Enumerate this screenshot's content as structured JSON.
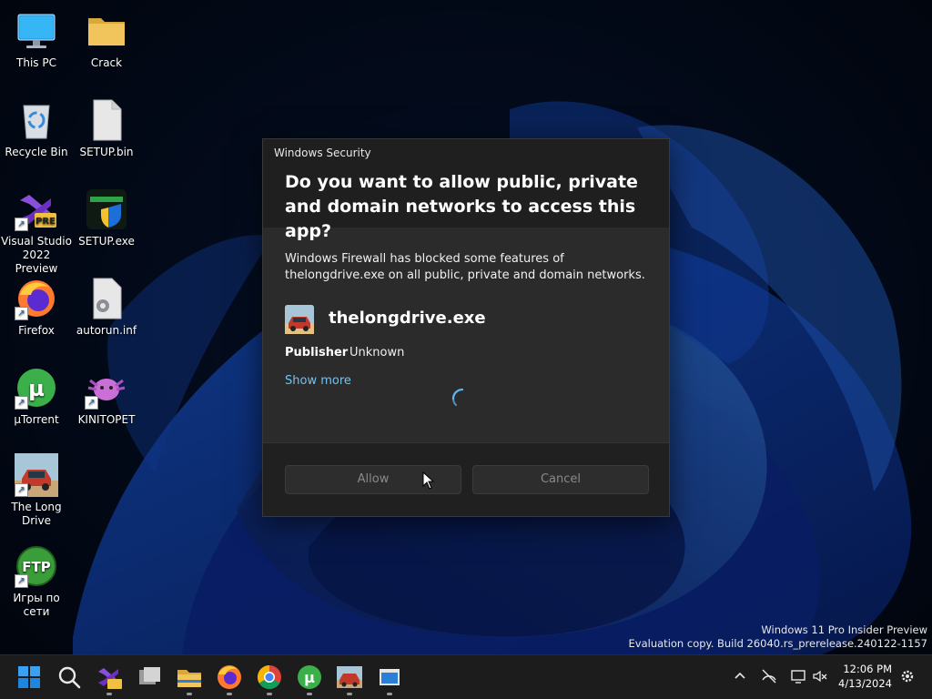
{
  "desktop": {
    "icons": [
      {
        "label": "This PC",
        "icon": "monitor-icon"
      },
      {
        "label": "Crack",
        "icon": "folder-icon"
      },
      {
        "label": "Recycle Bin",
        "icon": "recycle-bin-icon"
      },
      {
        "label": "SETUP.bin",
        "icon": "file-icon"
      },
      {
        "label": "Visual Studio 2022 Preview",
        "icon": "visual-studio-icon",
        "badge": "PRE"
      },
      {
        "label": "SETUP.exe",
        "icon": "setup-exe-icon"
      },
      {
        "label": "Firefox",
        "icon": "firefox-icon"
      },
      {
        "label": "autorun.inf",
        "icon": "settings-file-icon"
      },
      {
        "label": "µTorrent",
        "icon": "utorrent-icon"
      },
      {
        "label": "KINITOPET",
        "icon": "axolotl-icon"
      },
      {
        "label": "The Long Drive",
        "icon": "car-icon"
      },
      {
        "label": "Игры по сети",
        "icon": "ftp-icon",
        "badge": "FTP"
      }
    ]
  },
  "dialog": {
    "app_title": "Windows Security",
    "question": "Do you want to allow public, private and domain networks to access this app?",
    "description": "Windows Firewall has blocked some features of thelongdrive.exe on all public, private and domain networks.",
    "app_name": "thelongdrive.exe",
    "publisher_label": "Publisher",
    "publisher_value": "Unknown",
    "show_more": "Show more",
    "allow_label": "Allow",
    "cancel_label": "Cancel"
  },
  "watermark": {
    "line1": "Windows 11 Pro Insider Preview",
    "line2": "Evaluation copy. Build 26040.rs_prerelease.240122-1157"
  },
  "taskbar": {
    "apps": [
      "start-icon",
      "search-icon",
      "visual-studio-icon",
      "task-view-icon",
      "file-explorer-icon",
      "firefox-icon",
      "chrome-icon",
      "utorrent-icon",
      "the-long-drive-icon",
      "app-window-icon"
    ],
    "tray": [
      "chevron-up-icon",
      "network-icon",
      "display-icon",
      "volume-muted-icon"
    ],
    "time": "12:06 PM",
    "date": "4/13/2024",
    "accent_color": "#0078d4"
  },
  "colors": {
    "link": "#6cc4f5",
    "dialog_bg": "#2b2b2b",
    "dialog_header_bg": "#1f1f1f"
  }
}
